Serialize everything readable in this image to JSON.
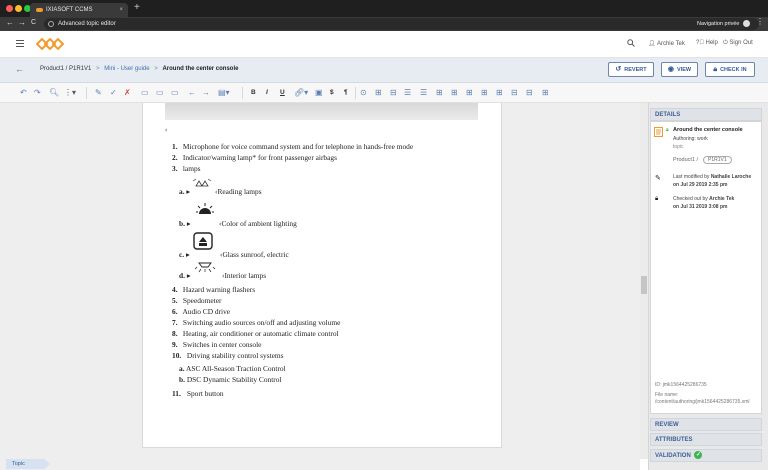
{
  "browser": {
    "tab_title": "IXIASOFT CCMS",
    "tab_close": "×",
    "new_tab": "+",
    "page_title": "Advanced topic editor",
    "private_label": "Navigation privée",
    "back": "←",
    "forward": "→",
    "reload": "C",
    "menu": "⋮"
  },
  "header": {
    "user": "Archie Tek",
    "help": "Help",
    "signout": "Sign Out"
  },
  "breadcrumb": {
    "back": "←",
    "product": "Product1 / P1R1V1",
    "sep1": ">",
    "guide": "Mini - User guide",
    "sep2": ">",
    "current": "Around the center console"
  },
  "actions": {
    "revert": "REVERT",
    "view": "VIEW",
    "checkin": "CHECK IN"
  },
  "toolbar": {
    "bold": "B",
    "italic": "I",
    "underline": "U",
    "dollar": "$",
    "pilcrow": "¶"
  },
  "document": {
    "cursor": "‹",
    "items": [
      {
        "num": "1.",
        "text": "Microphone for voice command system and for telephone in hands-free mode"
      },
      {
        "num": "2.",
        "text": "Indicator/warning lamp* for front passenger airbags"
      },
      {
        "num": "3.",
        "text": "lamps"
      },
      {
        "num": "4.",
        "text": "Hazard warning flashers"
      },
      {
        "num": "5.",
        "text": "Speedometer"
      },
      {
        "num": "6.",
        "text": "Audio CD drive"
      },
      {
        "num": "7.",
        "text": "Switching audio sources on/off and adjusting volume"
      },
      {
        "num": "8.",
        "text": "Heating, air conditioner or automatic climate control"
      },
      {
        "num": "9.",
        "text": "Switches in center console"
      },
      {
        "num": "10.",
        "text": "Driving stability control systems"
      },
      {
        "num": "11.",
        "text": "Sport button"
      }
    ],
    "lamp_items": [
      {
        "num": "a.",
        "text": "‹Reading lamps"
      },
      {
        "num": "b.",
        "text": "‹Color of ambient lighting"
      },
      {
        "num": "c.",
        "text": "‹Glass sunroof, electric"
      },
      {
        "num": "d.",
        "text": "‹Interior lamps"
      }
    ],
    "stability_items": [
      {
        "num": "a.",
        "text": "ASC All-Season Traction Control"
      },
      {
        "num": "b.",
        "text": "DSC Dynamic Stability Control"
      }
    ]
  },
  "details": {
    "heading": "DETAILS",
    "title": "Around the center console",
    "authoring": "Authoring: work",
    "topic_label": "topic",
    "product": "Product1 /",
    "version": "P1R1V1",
    "modified_label": "Last modified by",
    "modified_by": "Nathalie Laroche",
    "modified_on": "on Jul 29 2019 2:35 pm",
    "checked_label": "Checked out by",
    "checked_by": "Archie Tek",
    "checked_on": "on Jul 31 2019 3:08 pm",
    "id": "ID: jmk1564425286735",
    "file_name": "File name: /content/authoring/jmk1564425286735.xml"
  },
  "panels": {
    "review": "REVIEW",
    "attributes": "ATTRIBUTES",
    "validation": "VALIDATION"
  },
  "status": {
    "topic_tab": "Topic"
  },
  "colors": {
    "accent": "#2f5b96",
    "logo": "#f29a2e",
    "status_ok": "#3fb34f"
  }
}
